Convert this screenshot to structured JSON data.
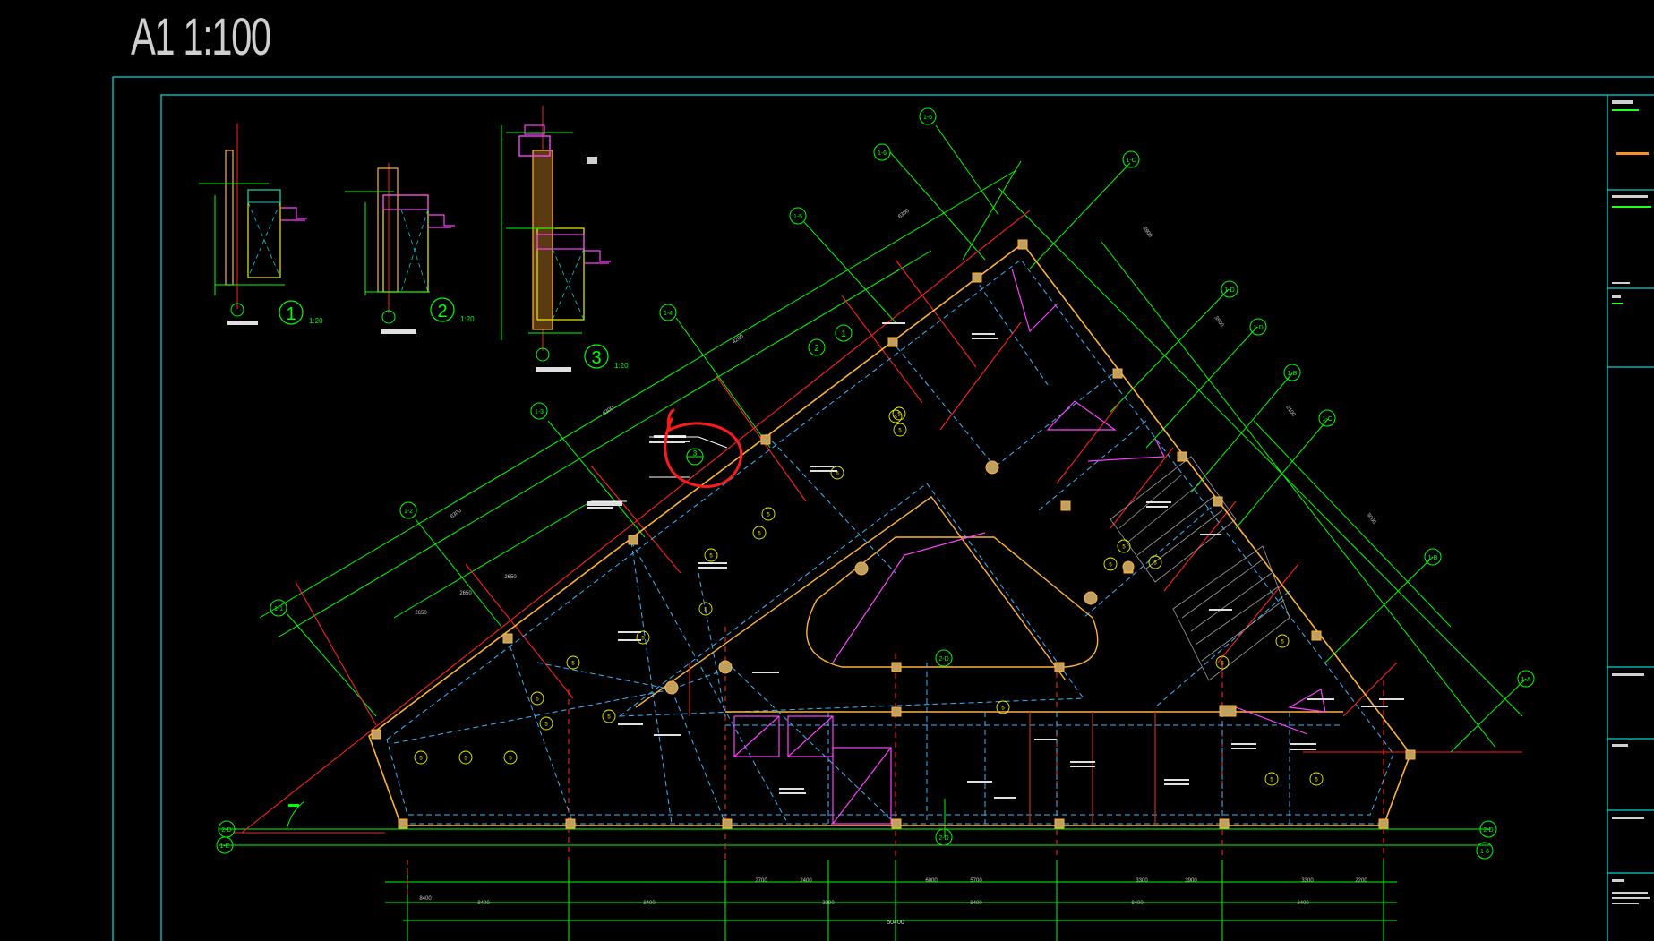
{
  "sheet": {
    "title": "A1 1:100"
  },
  "colors": {
    "background": "#000000",
    "frame": "#00d2d2",
    "grid": "#00ff00",
    "axis": "#ff2020",
    "beam": "#ffb33a",
    "beam_dash": "#3ab6ff",
    "label": "#ffffff",
    "tag": "#f0f000",
    "pink": "#ff40ff",
    "markup": "#ff1a1a"
  },
  "details": [
    {
      "number": "1",
      "scale": "1:20"
    },
    {
      "number": "2",
      "scale": "1:20"
    },
    {
      "number": "3",
      "scale": "1:20"
    }
  ],
  "axis_bubbles": [
    {
      "label": "1-1"
    },
    {
      "label": "1-2"
    },
    {
      "label": "1-3"
    },
    {
      "label": "1-4"
    },
    {
      "label": "1-5"
    },
    {
      "label": "1-6"
    },
    {
      "label": "1-A"
    },
    {
      "label": "1-B"
    },
    {
      "label": "1-C"
    },
    {
      "label": "1-D"
    },
    {
      "label": "1-E"
    },
    {
      "label": "2-D"
    },
    {
      "label": "2-D"
    },
    {
      "label": "2-D"
    },
    {
      "label": "1-E"
    },
    {
      "label": "1-6"
    }
  ],
  "dimensions": {
    "bottom_row1": [
      "2700",
      "2400",
      "3600",
      "6000",
      "5700",
      "3300",
      "3900",
      "3300",
      "2200"
    ],
    "bottom_row2": [
      "8400",
      "8400",
      "3300",
      "8400",
      "8400",
      "8400"
    ],
    "total": "50400",
    "left_diag": [
      "2650",
      "2650",
      "2650"
    ],
    "top_diag": [
      "6300",
      "4200",
      "6300"
    ],
    "right_diag": [
      "3900",
      "3900",
      "2100",
      "3000"
    ]
  },
  "tags": [
    "5",
    "5",
    "5",
    "5",
    "5",
    "5",
    "5",
    "5",
    "5",
    "5",
    "5",
    "5",
    "5",
    "5",
    "5",
    "5",
    "5",
    "5",
    "5",
    "5",
    "5",
    "5",
    "5",
    "5"
  ],
  "markup": {
    "detail_ref": "3"
  },
  "callouts": {
    "pointer": "2",
    "pointer_sub": "1"
  }
}
